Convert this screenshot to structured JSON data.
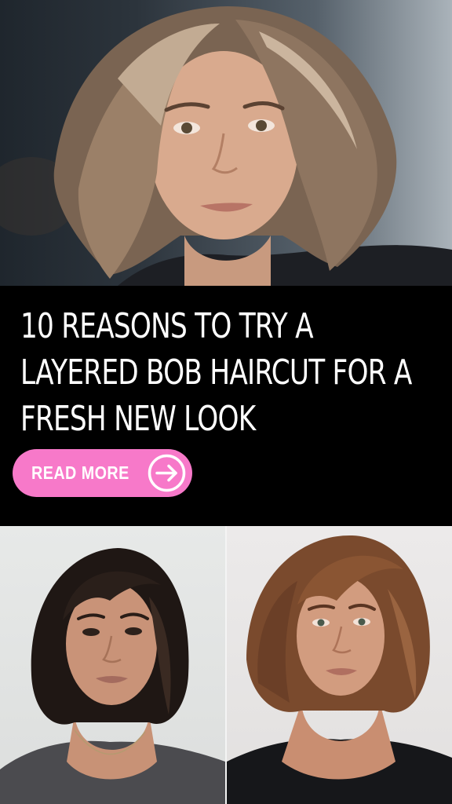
{
  "headline": {
    "line1": "10 REASONS TO TRY A",
    "line2": "LAYERED BOB HAIRCUT FOR A",
    "line3": "FRESH NEW LOOK"
  },
  "cta": {
    "label": "READ MORE",
    "icon": "arrow-right-circle-icon"
  },
  "colors": {
    "banner_background": "#000000",
    "headline_text": "#ffffff",
    "button_background": "#f779c9",
    "button_text": "#ffffff"
  },
  "images": [
    "woman-layered-bob-highlights-photo",
    "woman-dark-layered-bob-photo",
    "woman-auburn-layered-bob-photo"
  ]
}
